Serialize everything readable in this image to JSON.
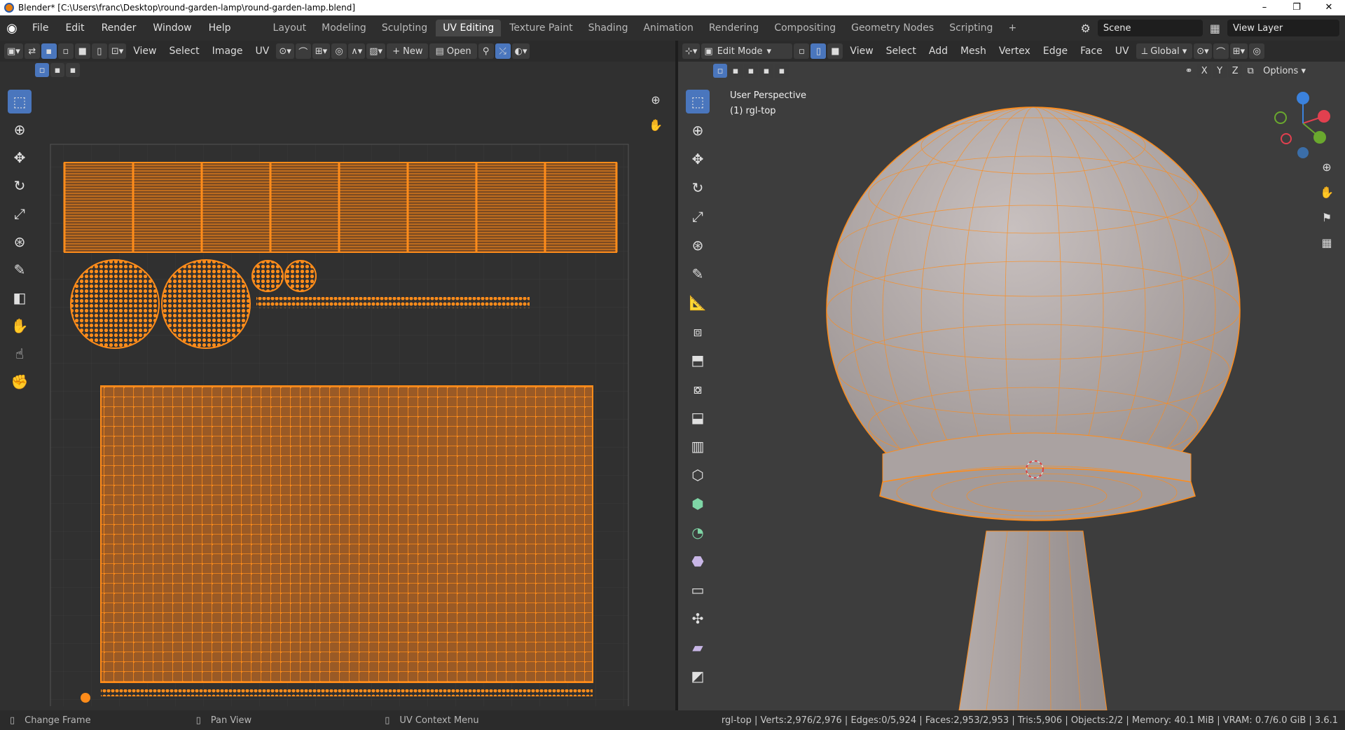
{
  "window": {
    "title": "Blender* [C:\\Users\\franc\\Desktop\\round-garden-lamp\\round-garden-lamp.blend]",
    "controls": [
      "–",
      "❐",
      "✕"
    ]
  },
  "menus": [
    "File",
    "Edit",
    "Render",
    "Window",
    "Help"
  ],
  "workspace_tabs": [
    "Layout",
    "Modeling",
    "Sculpting",
    "UV Editing",
    "Texture Paint",
    "Shading",
    "Animation",
    "Rendering",
    "Compositing",
    "Geometry Nodes",
    "Scripting"
  ],
  "active_workspace": "UV Editing",
  "scene": {
    "label": "Scene",
    "view_layer": "View Layer"
  },
  "uv_editor": {
    "menus": [
      "View",
      "Select",
      "Image",
      "UV"
    ],
    "new_label": "New",
    "open_label": "Open"
  },
  "viewport": {
    "mode": "Edit Mode",
    "menus": [
      "View",
      "Select",
      "Add",
      "Mesh",
      "Vertex",
      "Edge",
      "Face",
      "UV"
    ],
    "orientation": "Global",
    "axes": [
      "X",
      "Y",
      "Z"
    ],
    "options_label": "Options",
    "overlay_title": "User Perspective",
    "overlay_object": "(1) rgl-top",
    "colors": {
      "mesh": "#b4acab",
      "edge": "#ff8c1a",
      "bg": "#3d3d3d"
    }
  },
  "status": {
    "left": [
      {
        "icon": "mouse-left-icon",
        "label": "Change Frame"
      },
      {
        "icon": "mouse-middle-icon",
        "label": "Pan View"
      },
      {
        "icon": "mouse-right-icon",
        "label": "UV Context Menu"
      }
    ],
    "stats": "rgl-top | Verts:2,976/2,976 | Edges:0/5,924 | Faces:2,953/2,953 | Tris:5,906 | Objects:2/2 | Memory: 40.1 MiB | VRAM: 0.7/6.0 GiB | 3.6.1"
  }
}
